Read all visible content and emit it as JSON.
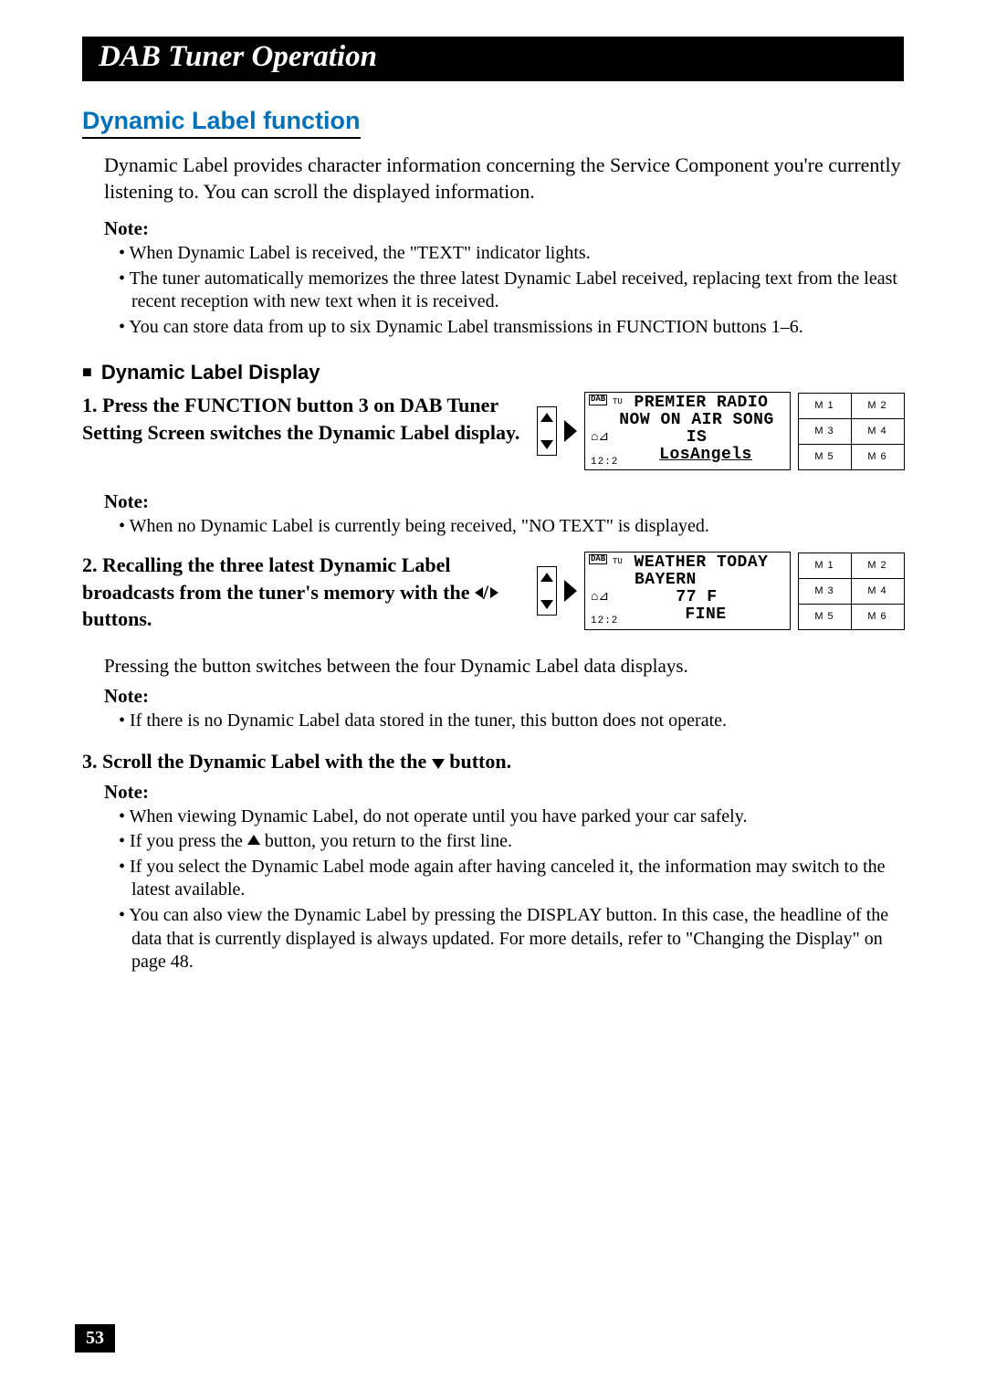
{
  "chapter_title": "DAB Tuner Operation",
  "section_title": "Dynamic Label function",
  "intro_text": "Dynamic Label provides character information concerning the Service Component you're currently listening to. You can scroll the displayed information.",
  "note_label": "Note:",
  "intro_notes": [
    "When Dynamic Label is received, the \"TEXT\" indicator lights.",
    "The tuner automatically memorizes the three latest Dynamic Label received, replacing text from the least recent reception with new text when it is received.",
    "You can store data from up to six Dynamic Label transmissions in FUNCTION buttons 1–6."
  ],
  "sub_heading": "Dynamic Label Display",
  "step1": {
    "num": "1.",
    "text": "Press the FUNCTION button 3 on DAB Tuner Setting Screen switches the Dynamic Label display."
  },
  "display1": {
    "dab": "DAB",
    "tu": "TU",
    "clock": "12:2",
    "line1": "PREMIER RADIO",
    "line2": "NOW ON AIR SONG",
    "line3": "IS",
    "line4": "LosAngels"
  },
  "preset_buttons": [
    "M 1",
    "M 2",
    "M 3",
    "M 4",
    "M 5",
    "M 6"
  ],
  "step1_note_label": "Note:",
  "step1_notes": [
    "When no Dynamic Label is currently being received, \"NO TEXT\" is displayed."
  ],
  "step2": {
    "num": "2.",
    "text_a": "Recalling the three latest Dynamic Label broadcasts from the tuner's memory with the ",
    "text_b": " buttons."
  },
  "display2": {
    "dab": "DAB",
    "tu": "TU",
    "clock": "12:2",
    "line1": "WEATHER TODAY",
    "line2": "BAYERN",
    "line3": "77 F",
    "line4": "FINE"
  },
  "step2_follow": "Pressing the button switches between the four Dynamic Label data displays.",
  "step2_note_label": "Note:",
  "step2_notes": [
    "If there is no Dynamic Label data stored in the tuner, this button does not operate."
  ],
  "step3": {
    "num": "3.",
    "text_a": "Scroll the Dynamic Label with the the ",
    "text_b": " button."
  },
  "step3_note_label": "Note:",
  "step3_notes": [
    "When viewing Dynamic Label, do not operate until you have parked your car safely.",
    "If you press the ▲ button, you return to the first line.",
    "If you select the Dynamic Label mode again after having canceled it, the information may switch to the latest available.",
    "You can also view the Dynamic Label by pressing the DISPLAY button. In this case, the headline of the data that is currently displayed is always updated. For more details, refer to \"Changing the Display\" on page 48."
  ],
  "page_number": "53"
}
